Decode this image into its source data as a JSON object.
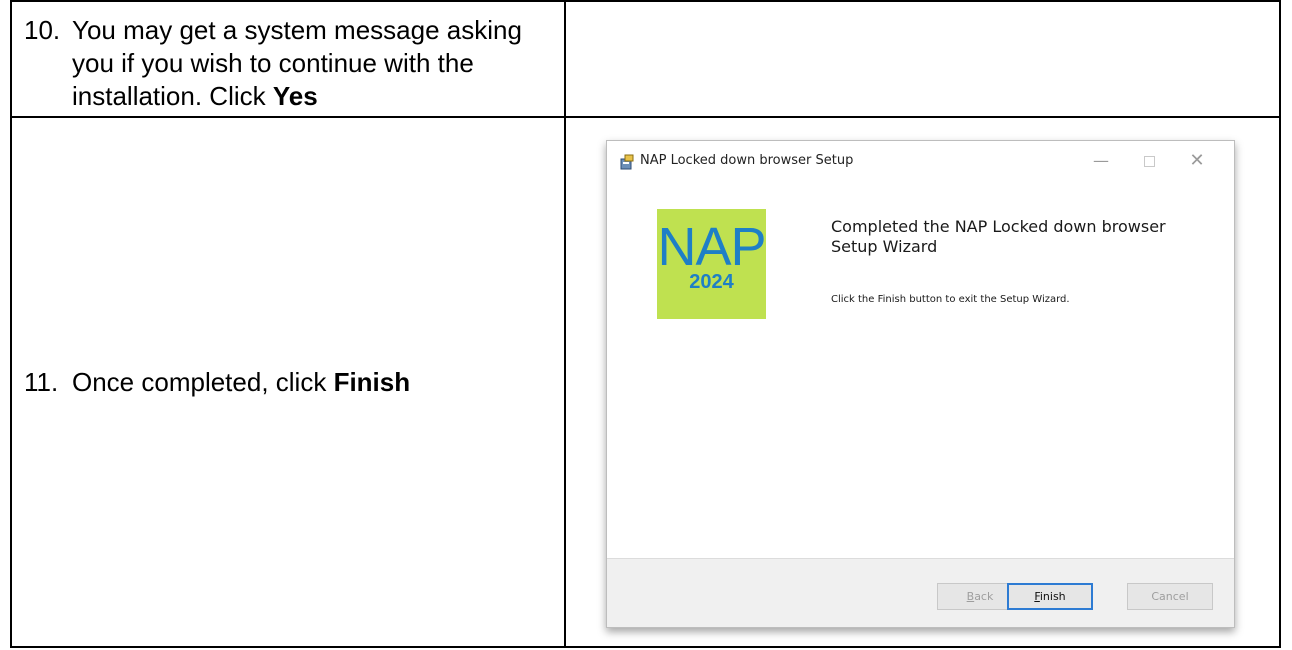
{
  "steps": [
    {
      "number": "10.",
      "text_before": "You may get a system message asking you if you wish to continue with the installation.  Click ",
      "bold": "Yes"
    },
    {
      "number": "11.",
      "text_before": "Once completed, click ",
      "bold": "Finish"
    }
  ],
  "dialog": {
    "title": "NAP Locked down browser Setup",
    "window_controls": {
      "minimize": "—",
      "close": "✕"
    },
    "logo": {
      "text": "NAP",
      "year": "2024",
      "bg_color": "#bfe150",
      "text_color": "#1e7fc6"
    },
    "heading": "Completed the NAP Locked down browser Setup Wizard",
    "subtext": "Click the Finish button to exit the Setup Wizard.",
    "buttons": {
      "back": {
        "mnemonic": "B",
        "rest": "ack"
      },
      "finish": {
        "mnemonic": "F",
        "rest": "inish"
      },
      "cancel": "Cancel"
    }
  }
}
